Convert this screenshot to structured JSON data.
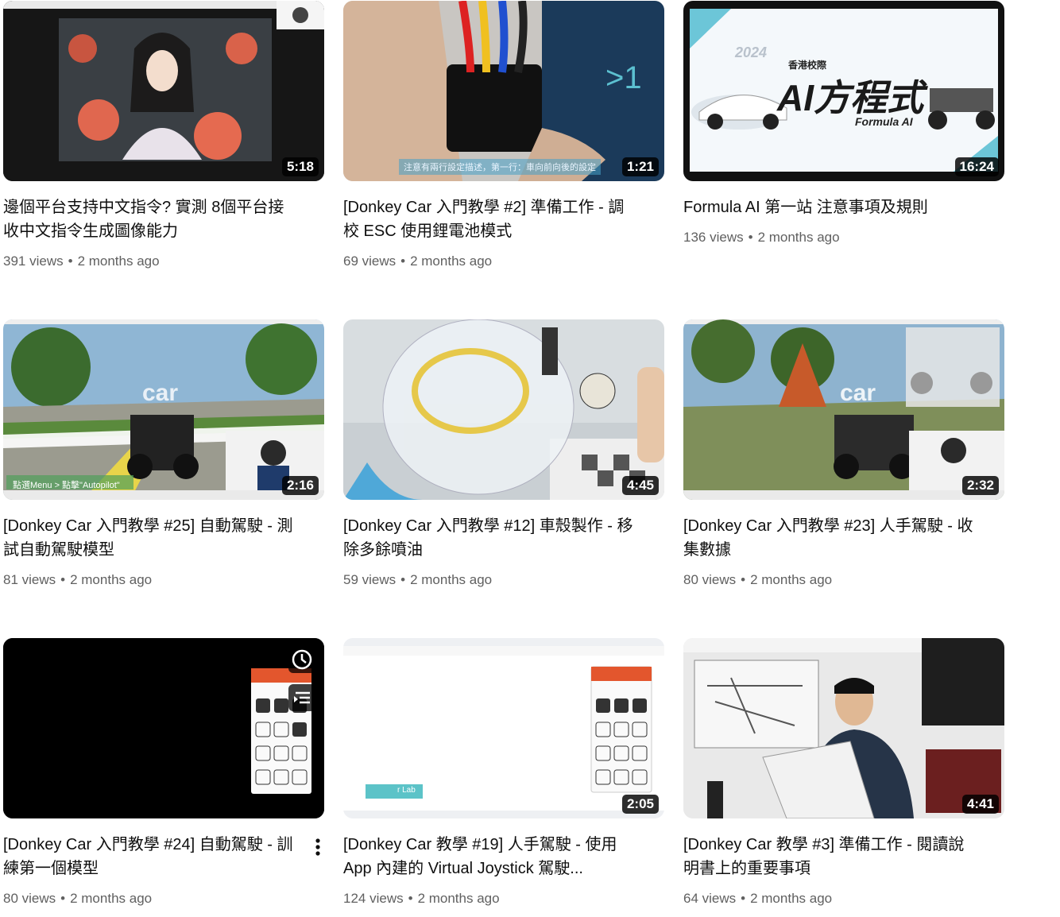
{
  "videos": [
    {
      "title": "邊個平台支持中文指令? 實測 8個平台接收中文指令生成圖像能力",
      "views": "391 views",
      "age": "2 months ago",
      "duration": "5:18"
    },
    {
      "title": "[Donkey Car 入門教學 #2] 準備工作 - 調校 ESC 使用鋰電池模式",
      "views": "69 views",
      "age": "2 months ago",
      "duration": "1:21",
      "caption": "注意有兩行設定描述，第一行：車向前向後的設定"
    },
    {
      "title": "Formula AI 第一站 注意事項及規則",
      "views": "136 views",
      "age": "2 months ago",
      "duration": "16:24",
      "thumb_text": {
        "year": "2024",
        "school": "香港校際",
        "big": "AI方程式",
        "sub": "Formula AI"
      }
    },
    {
      "title": "[Donkey Car 入門教學 #25] 自動駕駛 - 測試自動駕駛模型",
      "views": "81 views",
      "age": "2 months ago",
      "duration": "2:16",
      "thumb_text": {
        "car": "car",
        "caption": "點選Menu > 點擊\"Autopilot\""
      }
    },
    {
      "title": "[Donkey Car 入門教學 #12] 車殼製作 - 移除多餘噴油",
      "views": "59 views",
      "age": "2 months ago",
      "duration": "4:45"
    },
    {
      "title": "[Donkey Car 入門教學 #23] 人手駕駛 - 收集數據",
      "views": "80 views",
      "age": "2 months ago",
      "duration": "2:32",
      "thumb_text": {
        "car": "car"
      }
    },
    {
      "title": "[Donkey Car 入門教學 #24] 自動駕駛 - 訓練第一個模型",
      "views": "80 views",
      "age": "2 months ago",
      "duration": ""
    },
    {
      "title": "[Donkey Car 教學 #19] 人手駕駛 - 使用 App 內建的 Virtual Joystick 駕駛...",
      "views": "124 views",
      "age": "2 months ago",
      "duration": "2:05",
      "thumb_text": {
        "lab": "r Lab"
      }
    },
    {
      "title": "[Donkey Car 教學 #3] 準備工作 - 閱讀說明書上的重要事項",
      "views": "64 views",
      "age": "2 months ago",
      "duration": "4:41"
    }
  ],
  "icons": {
    "more": "more-vert-icon",
    "watch_later": "clock-icon",
    "queue": "add-to-queue-icon"
  },
  "colors": {
    "meta": "#606060",
    "title": "#0f0f0f",
    "duration_bg": "#000000"
  }
}
